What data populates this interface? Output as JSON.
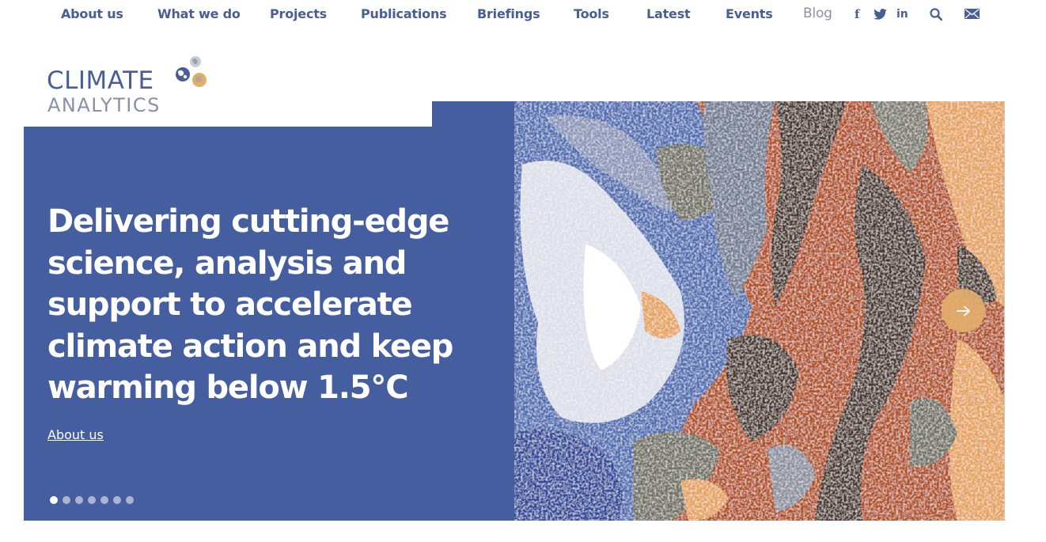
{
  "nav": {
    "items": [
      {
        "label": "About us"
      },
      {
        "label": "What we do"
      },
      {
        "label": "Projects"
      },
      {
        "label": "Publications"
      },
      {
        "label": "Briefings"
      },
      {
        "label": "Tools"
      },
      {
        "label": "Latest"
      },
      {
        "label": "Events"
      }
    ],
    "blog": "Blog",
    "icons": [
      "facebook-icon",
      "twitter-icon",
      "linkedin-icon",
      "search-icon",
      "mail-icon"
    ],
    "icon_text": {
      "facebook": "f",
      "linkedin": "in"
    }
  },
  "logo": {
    "line1": "CLIMATE",
    "line2": "ANALYTICS"
  },
  "hero": {
    "heading": "Delivering cutting-edge science, analysis and support to accelerate climate action and keep warming below 1.5°C",
    "link": "About us",
    "slides_total": 7,
    "slide_active": 1,
    "next_icon": "arrow-right-icon"
  },
  "colors": {
    "brand_blue": "#455e9f",
    "nav_text": "#4a5e96",
    "accent_orange": "#e2ae6c",
    "image_palette": [
      "#b3501f",
      "#4c342b",
      "#4e6db3",
      "#dcdfea",
      "#e6a25a",
      "#6f6f64",
      "#2f4a9c"
    ]
  }
}
